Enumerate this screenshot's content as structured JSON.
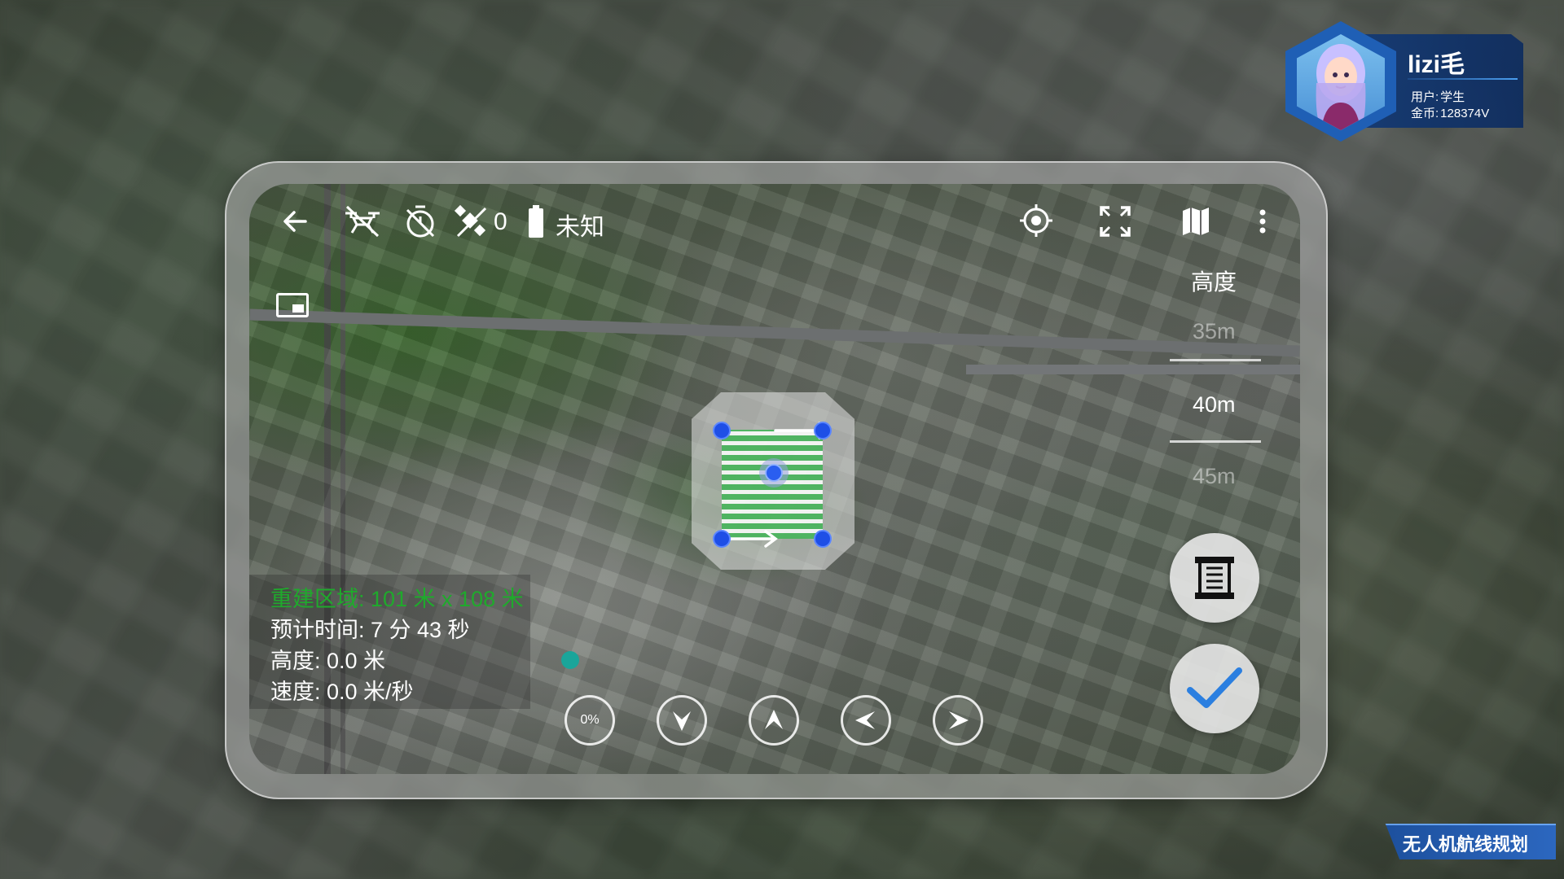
{
  "toolbar": {
    "back_icon": "arrow-left-icon",
    "drone_status_icon": "drone-disconnected-icon",
    "timer_icon": "timer-off-icon",
    "satellite_icon": "satellite-off-icon",
    "satellite_count": "0",
    "battery_icon": "battery-icon",
    "battery_status": "未知",
    "locate_icon": "crosshair-icon",
    "fullscreen_icon": "fullscreen-icon",
    "map_icon": "map-icon",
    "more_icon": "more-vertical-icon"
  },
  "altitude": {
    "title": "高度",
    "ticks": [
      "35m",
      "40m",
      "45m"
    ],
    "current_index": 1
  },
  "info": {
    "area": "重建区域: 101 米 x 108 米",
    "estimated_time": "预计时间: 7 分 43 秒",
    "height": "高度: 0.0 米",
    "speed": "速度: 0.0 米/秒"
  },
  "controls": {
    "progress": "0%",
    "buttons": [
      "arrow-down-icon",
      "arrow-up-icon",
      "arrow-left-icon",
      "arrow-right-icon"
    ]
  },
  "user": {
    "name": "lizi毛",
    "role_label": "用户:",
    "role": "学生",
    "coins_label": "金币:",
    "coins": "128374V"
  },
  "badge": {
    "text": "无人机航线规划"
  },
  "colors": {
    "accent_blue": "#2a5ef0",
    "area_green": "#1faa2c",
    "confirm_blue": "#2b7fe0",
    "user_panel": "#143c78"
  }
}
